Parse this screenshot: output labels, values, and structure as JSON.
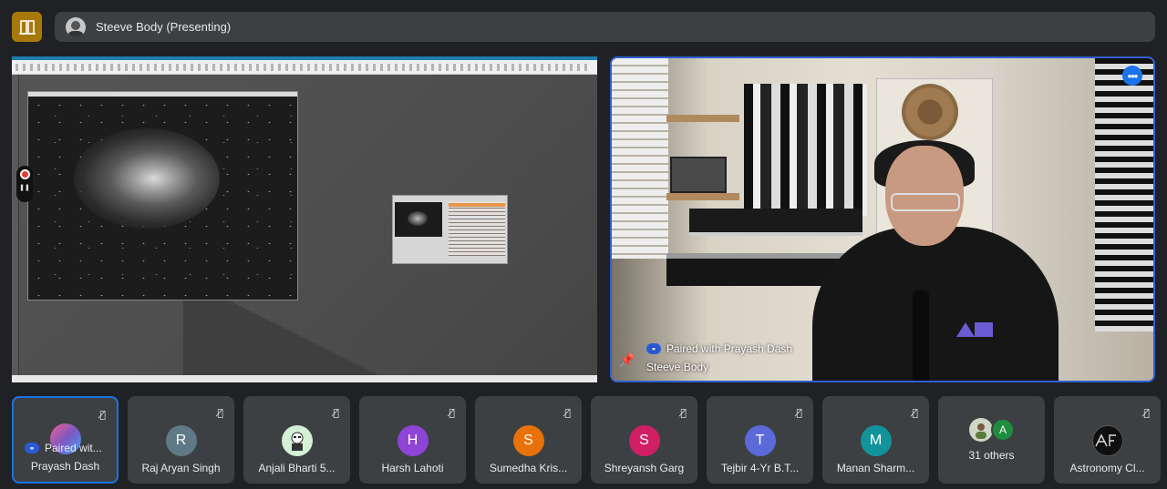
{
  "top_bar": {
    "presenter_label": "Steeve Body (Presenting)"
  },
  "camera_tile": {
    "paired_label": "Paired with Prayash Dash",
    "name": "Steeve Body",
    "more_icon": "more-horiz-icon",
    "pin_icon": "pin-icon"
  },
  "participants": [
    {
      "name": "Prayash Dash",
      "initial": "",
      "color": "#a64bd8",
      "paired_label": "Paired wit...",
      "active": true
    },
    {
      "name": "Raj Aryan Singh",
      "initial": "R",
      "color": "#5f7a86"
    },
    {
      "name": "Anjali Bharti 5...",
      "initial": "",
      "color": "#d4f0d6"
    },
    {
      "name": "Harsh Lahoti",
      "initial": "H",
      "color": "#8e44d6"
    },
    {
      "name": "Sumedha Kris...",
      "initial": "S",
      "color": "#e8710a"
    },
    {
      "name": "Shreyansh Garg",
      "initial": "S",
      "color": "#d01f63"
    },
    {
      "name": "Tejbir 4-Yr B.T...",
      "initial": "T",
      "color": "#5b6ad8"
    },
    {
      "name": "Manan Sharm...",
      "initial": "M",
      "color": "#12939a"
    },
    {
      "name": "31 others",
      "initial": "A",
      "color": "#1e8e3e"
    },
    {
      "name": "Astronomy Cl...",
      "initial": "",
      "color": "#101010"
    }
  ],
  "colors": {
    "accent": "#1a73e8",
    "tile_bg": "#3c4043",
    "page_bg": "#202124",
    "logo_bg": "#a8780b"
  }
}
